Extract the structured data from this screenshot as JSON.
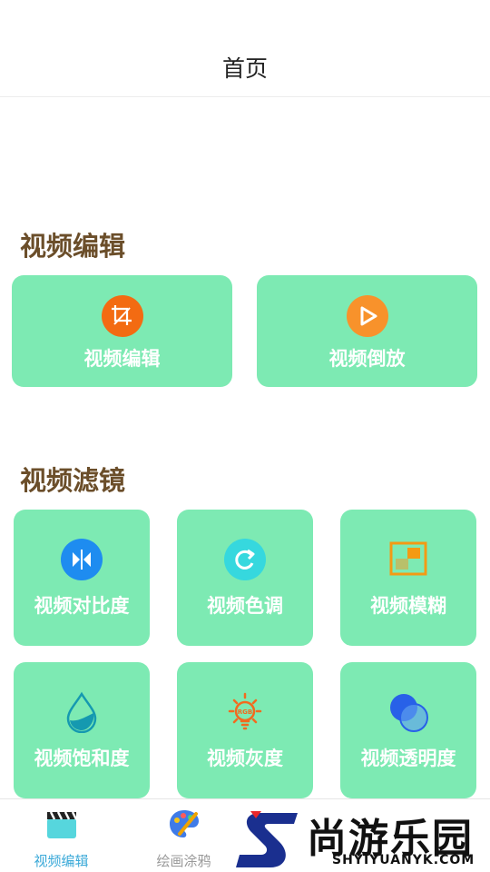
{
  "header": {
    "title": "首页"
  },
  "sections": {
    "edit": {
      "title": "视频编辑"
    },
    "filter": {
      "title": "视频滤镜"
    }
  },
  "edit_cards": [
    {
      "label": "视频编辑",
      "icon": "crop-icon",
      "color": "#f36b12"
    },
    {
      "label": "视频倒放",
      "icon": "play-icon",
      "color": "#f8922b"
    }
  ],
  "filter_cards": [
    {
      "label": "视频对比度",
      "icon": "contrast-icon",
      "color": "#1e8cf0"
    },
    {
      "label": "视频色调",
      "icon": "refresh-icon",
      "color": "#36d8de"
    },
    {
      "label": "视频模糊",
      "icon": "blur-icon",
      "color": "#f39a14"
    },
    {
      "label": "视频饱和度",
      "icon": "drop-icon",
      "color": "#1599b0"
    },
    {
      "label": "视频灰度",
      "icon": "bulb-rgb-icon",
      "color": "#f26a1e"
    },
    {
      "label": "视频透明度",
      "icon": "circles-icon",
      "color": "#2861e8"
    }
  ],
  "tabs": [
    {
      "label": "视频编辑",
      "icon": "clapper-icon",
      "active": true,
      "color": "#3aa9d8"
    },
    {
      "label": "绘画涂鸦",
      "icon": "palette-icon",
      "active": false,
      "color": "#999999"
    }
  ],
  "watermark": {
    "text": "尚游乐园",
    "sub": "SHYIYUANYK.COM"
  },
  "colors": {
    "card": "#7deab3",
    "section_title": "#6b4e2a",
    "tab_active": "#3aa9d8"
  }
}
